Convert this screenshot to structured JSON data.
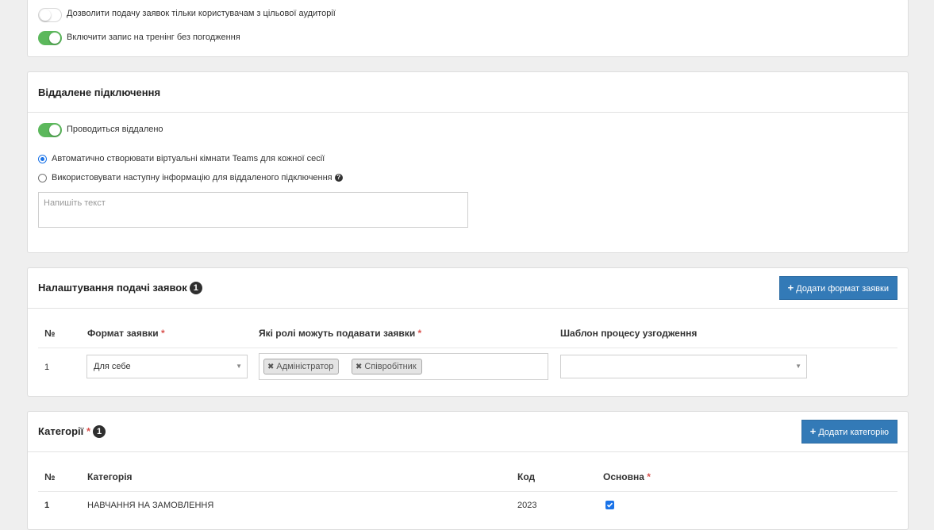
{
  "top_panel": {
    "toggles": [
      {
        "label": "Дозволити подачу заявок тільки користувачам з цільової аудиторії",
        "on": false
      },
      {
        "label": "Включити запис на тренінг без погодження",
        "on": true
      }
    ]
  },
  "remote": {
    "title": "Віддалене підключення",
    "toggle_label": "Проводиться віддалено",
    "radio_auto": "Автоматично створювати віртуальні кімнати Teams для кожної сесії",
    "radio_manual": "Використовувати наступну інформацію для віддаленого підключення",
    "help_icon": "?",
    "textarea_placeholder": "Напишіть текст"
  },
  "requests": {
    "title": "Налаштування подачі заявок",
    "count": "1",
    "add_button": "Додати формат заявки",
    "columns": [
      "№",
      "Формат заявки",
      "Які ролі можуть подавати заявки",
      "Шаблон процесу узгодження"
    ],
    "required_mark": "*",
    "rows": [
      {
        "num": "1",
        "format": "Для себе",
        "roles": [
          "Адміністратор",
          "Співробітник"
        ],
        "template": ""
      }
    ]
  },
  "categories": {
    "title": "Категорії",
    "count": "1",
    "add_button": "Додати категорію",
    "columns": [
      "№",
      "Категорія",
      "Код",
      "Основна"
    ],
    "rows": [
      {
        "num": "1",
        "category": "НАВЧАННЯ НА ЗАМОВЛЕННЯ",
        "code": "2023",
        "main": true
      }
    ]
  },
  "colors": {
    "accent": "#337ab7",
    "toggle_on": "#5cb85c",
    "badge": "#2f2f2f",
    "required": "#d9534f"
  }
}
